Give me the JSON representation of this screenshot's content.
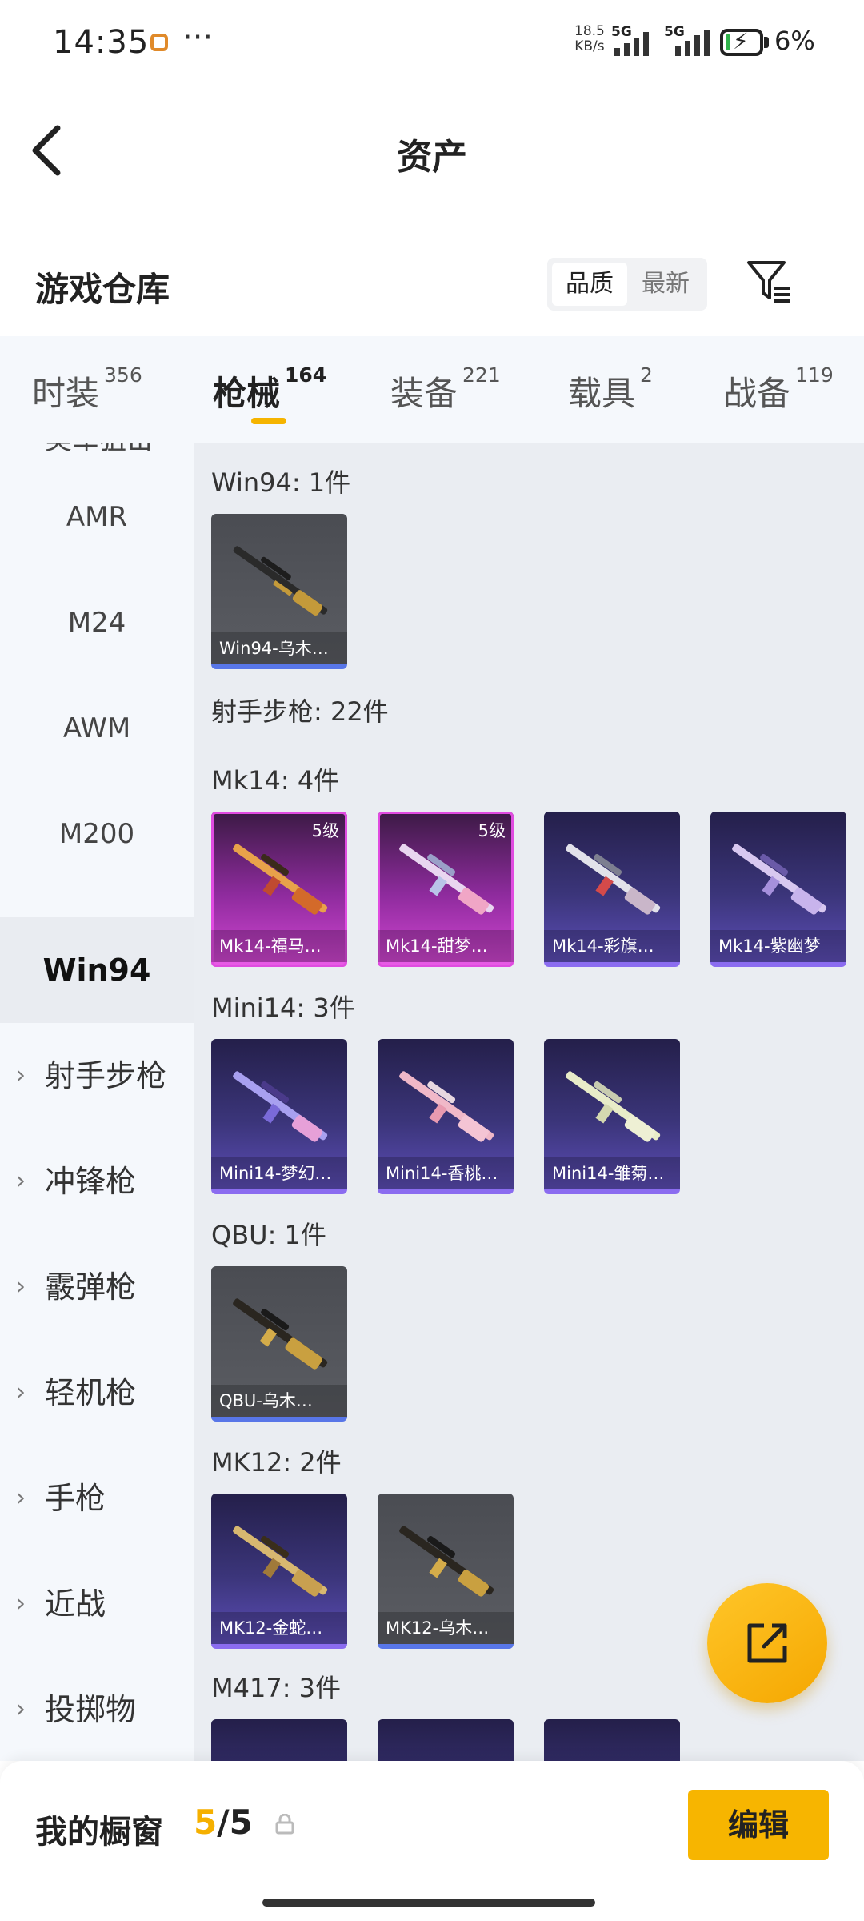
{
  "status_bar": {
    "time": "14:35",
    "net_speed_value": "18.5",
    "net_speed_unit": "KB/s",
    "sim1": "5G",
    "sim2": "5G",
    "battery": "6%",
    "more": "···"
  },
  "header": {
    "title": "资产"
  },
  "warehouse": {
    "title": "游戏仓库",
    "sort_options": [
      "品质",
      "最新"
    ],
    "sort_selected": "品质"
  },
  "tabs": [
    {
      "label": "时装",
      "count": "356",
      "active": false
    },
    {
      "label": "枪械",
      "count": "164",
      "active": true
    },
    {
      "label": "装备",
      "count": "221",
      "active": false
    },
    {
      "label": "载具",
      "count": "2",
      "active": false
    },
    {
      "label": "战备",
      "count": "119",
      "active": false
    }
  ],
  "sidebar": {
    "cut_top": "美军狙击",
    "items": [
      "AMR",
      "M24",
      "AWM",
      "M200",
      "Win94"
    ],
    "active": "Win94",
    "categories": [
      "射手步枪",
      "冲锋枪",
      "霰弹枪",
      "轻机枪",
      "手枪",
      "近战",
      "投掷物"
    ]
  },
  "content": {
    "section_header": "射手步枪: 22件",
    "groups": [
      {
        "title": "Win94: 1件",
        "items": [
          {
            "name": "Win94-乌木…",
            "rarity": "gray",
            "level": ""
          }
        ]
      },
      {
        "title": "Mk14: 4件",
        "items": [
          {
            "name": "Mk14-福马…",
            "rarity": "pink",
            "level": "5级"
          },
          {
            "name": "Mk14-甜梦…",
            "rarity": "pink",
            "level": "5级"
          },
          {
            "name": "Mk14-彩旗…",
            "rarity": "purple",
            "level": ""
          },
          {
            "name": "Mk14-紫幽梦",
            "rarity": "purple",
            "level": ""
          }
        ]
      },
      {
        "title": "Mini14: 3件",
        "items": [
          {
            "name": "Mini14-梦幻…",
            "rarity": "purple",
            "level": ""
          },
          {
            "name": "Mini14-香桃…",
            "rarity": "purple",
            "level": ""
          },
          {
            "name": "Mini14-雏菊…",
            "rarity": "purple",
            "level": ""
          }
        ]
      },
      {
        "title": "QBU: 1件",
        "items": [
          {
            "name": "QBU-乌木…",
            "rarity": "gray",
            "level": ""
          }
        ]
      },
      {
        "title": "MK12: 2件",
        "items": [
          {
            "name": "MK12-金蛇…",
            "rarity": "purple",
            "level": ""
          },
          {
            "name": "MK12-乌木…",
            "rarity": "gray",
            "level": ""
          }
        ]
      },
      {
        "title": "M417: 3件",
        "items": []
      }
    ]
  },
  "bottom_bar": {
    "label": "我的橱窗",
    "current": "5",
    "separator": "/",
    "total": "5",
    "edit_label": "编辑"
  },
  "colors": {
    "accent": "#f5b400",
    "purple_rarity": "#8b6cf0",
    "pink_rarity": "#e04be0",
    "gray_rarity": "#5876e8"
  },
  "icons": [
    "back-icon",
    "filter-icon",
    "share-icon",
    "lock-icon",
    "chevron-right-icon"
  ]
}
